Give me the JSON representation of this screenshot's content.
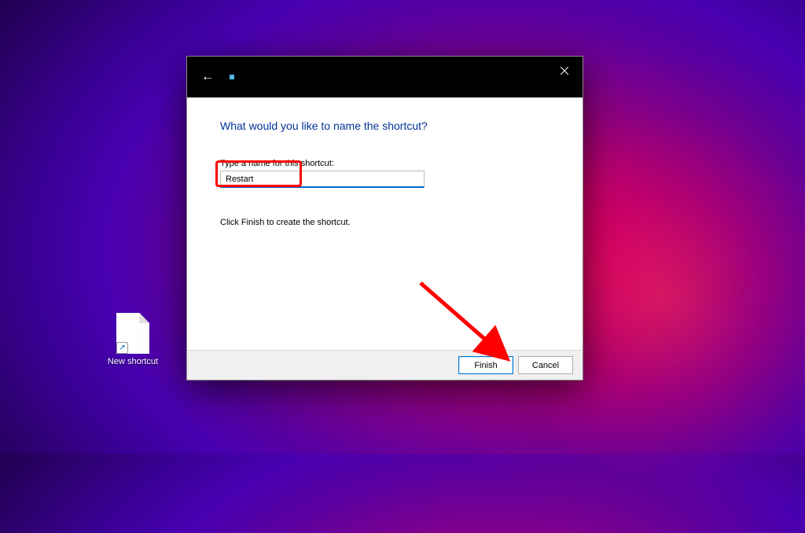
{
  "desktop": {
    "shortcut_label": "New shortcut"
  },
  "wizard": {
    "heading": "What would you like to name the shortcut?",
    "field_label": "Type a name for this shortcut:",
    "input_value": "Restart",
    "hint": "Click Finish to create the shortcut.",
    "buttons": {
      "finish": "Finish",
      "cancel": "Cancel"
    }
  },
  "annotations": {
    "arrow_color": "#ff0000",
    "highlight_target": "input-value",
    "arrow_target": "finish-button"
  }
}
